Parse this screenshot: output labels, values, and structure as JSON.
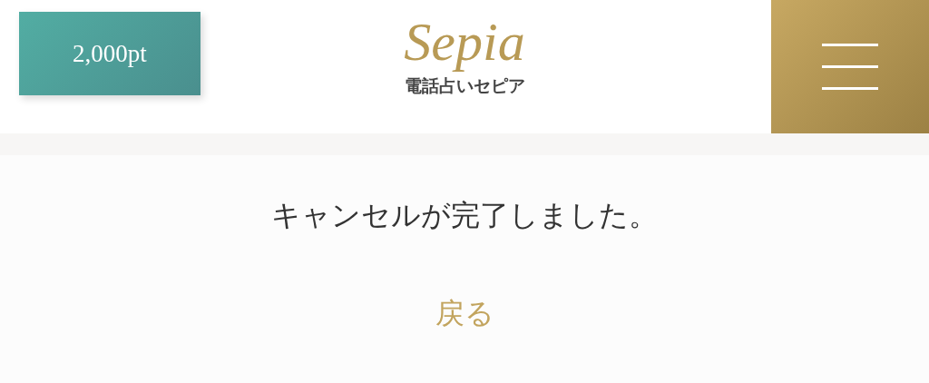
{
  "header": {
    "points": "2,000pt",
    "logo": "Sepia",
    "subtitle": "電話占いセピア"
  },
  "message": "キャンセルが完了しました。",
  "back_link": "戻る"
}
